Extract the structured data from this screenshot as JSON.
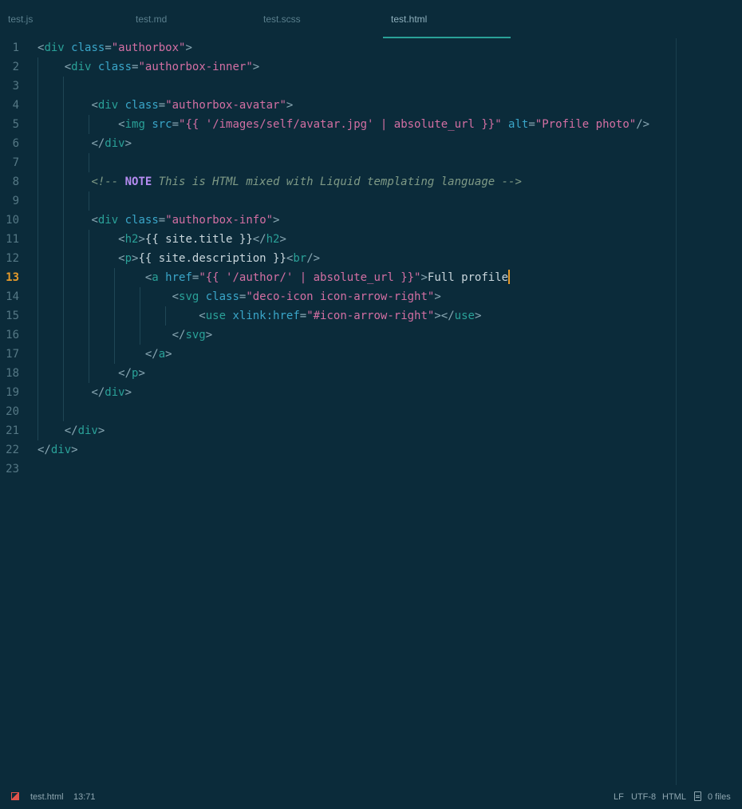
{
  "tabs": [
    {
      "label": "test.js",
      "active": false
    },
    {
      "label": "test.md",
      "active": false
    },
    {
      "label": "test.scss",
      "active": false
    },
    {
      "label": "test.html",
      "active": true
    }
  ],
  "editor": {
    "current_line": 13,
    "line_numbers": [
      "1",
      "2",
      "3",
      "4",
      "5",
      "6",
      "7",
      "8",
      "9",
      "10",
      "11",
      "12",
      "13",
      "14",
      "15",
      "16",
      "17",
      "18",
      "19",
      "20",
      "21",
      "22",
      "23"
    ],
    "lines": [
      [
        [
          "p",
          "<"
        ],
        [
          "t",
          "div"
        ],
        [
          "a",
          " class"
        ],
        [
          "p",
          "="
        ],
        [
          "s",
          "\"authorbox\""
        ],
        [
          "p",
          ">"
        ]
      ],
      [
        [
          "x",
          "    "
        ],
        [
          "p",
          "<"
        ],
        [
          "t",
          "div"
        ],
        [
          "a",
          " class"
        ],
        [
          "p",
          "="
        ],
        [
          "s",
          "\"authorbox-inner\""
        ],
        [
          "p",
          ">"
        ]
      ],
      [],
      [
        [
          "x",
          "        "
        ],
        [
          "p",
          "<"
        ],
        [
          "t",
          "div"
        ],
        [
          "a",
          " class"
        ],
        [
          "p",
          "="
        ],
        [
          "s",
          "\"authorbox-avatar\""
        ],
        [
          "p",
          ">"
        ]
      ],
      [
        [
          "x",
          "            "
        ],
        [
          "p",
          "<"
        ],
        [
          "t",
          "img"
        ],
        [
          "a",
          " src"
        ],
        [
          "p",
          "="
        ],
        [
          "s",
          "\"{{ '/images/self/avatar.jpg' | absolute_url }}\""
        ],
        [
          "a",
          " alt"
        ],
        [
          "p",
          "="
        ],
        [
          "s",
          "\"Profile photo\""
        ],
        [
          "p",
          "/>"
        ]
      ],
      [
        [
          "x",
          "        "
        ],
        [
          "p",
          "</"
        ],
        [
          "t",
          "div"
        ],
        [
          "p",
          ">"
        ]
      ],
      [],
      [
        [
          "x",
          "        "
        ],
        [
          "c",
          "<!-- "
        ],
        [
          "n",
          "NOTE"
        ],
        [
          "c",
          " This is HTML mixed with Liquid templating language -->"
        ]
      ],
      [],
      [
        [
          "x",
          "        "
        ],
        [
          "p",
          "<"
        ],
        [
          "t",
          "div"
        ],
        [
          "a",
          " class"
        ],
        [
          "p",
          "="
        ],
        [
          "s",
          "\"authorbox-info\""
        ],
        [
          "p",
          ">"
        ]
      ],
      [
        [
          "x",
          "            "
        ],
        [
          "p",
          "<"
        ],
        [
          "t",
          "h2"
        ],
        [
          "p",
          ">"
        ],
        [
          "x",
          "{{ site.title }}"
        ],
        [
          "p",
          "</"
        ],
        [
          "t",
          "h2"
        ],
        [
          "p",
          ">"
        ]
      ],
      [
        [
          "x",
          "            "
        ],
        [
          "p",
          "<"
        ],
        [
          "t",
          "p"
        ],
        [
          "p",
          ">"
        ],
        [
          "x",
          "{{ site.description }}"
        ],
        [
          "p",
          "<"
        ],
        [
          "t",
          "br"
        ],
        [
          "p",
          "/>"
        ]
      ],
      [
        [
          "x",
          "                "
        ],
        [
          "p",
          "<"
        ],
        [
          "t",
          "a"
        ],
        [
          "a",
          " href"
        ],
        [
          "p",
          "="
        ],
        [
          "s",
          "\"{{ '/author/' | absolute_url }}\""
        ],
        [
          "p",
          ">"
        ],
        [
          "x",
          "Full profile"
        ]
      ],
      [
        [
          "x",
          "                    "
        ],
        [
          "p",
          "<"
        ],
        [
          "t",
          "svg"
        ],
        [
          "a",
          " class"
        ],
        [
          "p",
          "="
        ],
        [
          "s",
          "\"deco-icon icon-arrow-right\""
        ],
        [
          "p",
          ">"
        ]
      ],
      [
        [
          "x",
          "                        "
        ],
        [
          "p",
          "<"
        ],
        [
          "t",
          "use"
        ],
        [
          "a",
          " xlink:href"
        ],
        [
          "p",
          "="
        ],
        [
          "s",
          "\"#icon-arrow-right\""
        ],
        [
          "p",
          "></"
        ],
        [
          "t",
          "use"
        ],
        [
          "p",
          ">"
        ]
      ],
      [
        [
          "x",
          "                    "
        ],
        [
          "p",
          "</"
        ],
        [
          "t",
          "svg"
        ],
        [
          "p",
          ">"
        ]
      ],
      [
        [
          "x",
          "                "
        ],
        [
          "p",
          "</"
        ],
        [
          "t",
          "a"
        ],
        [
          "p",
          ">"
        ]
      ],
      [
        [
          "x",
          "            "
        ],
        [
          "p",
          "</"
        ],
        [
          "t",
          "p"
        ],
        [
          "p",
          ">"
        ]
      ],
      [
        [
          "x",
          "        "
        ],
        [
          "p",
          "</"
        ],
        [
          "t",
          "div"
        ],
        [
          "p",
          ">"
        ]
      ],
      [],
      [
        [
          "x",
          "    "
        ],
        [
          "p",
          "</"
        ],
        [
          "t",
          "div"
        ],
        [
          "p",
          ">"
        ]
      ],
      [
        [
          "p",
          "</"
        ],
        [
          "t",
          "div"
        ],
        [
          "p",
          ">"
        ]
      ],
      []
    ]
  },
  "status": {
    "filename": "test.html",
    "position": "13:71",
    "line_ending": "LF",
    "encoding": "UTF-8",
    "language": "HTML",
    "files": "0 files"
  },
  "colors": {
    "background": "#0b2b3a",
    "tag": "#2aa198",
    "attribute": "#3aa6c9",
    "string": "#d36fa3",
    "comment": "#7f9a86",
    "note": "#b68cf2",
    "cursor": "#e59a2b"
  }
}
